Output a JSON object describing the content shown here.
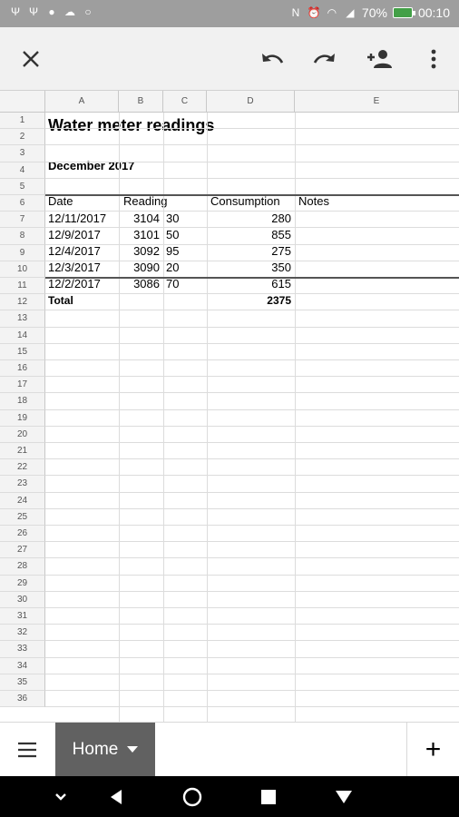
{
  "statusbar": {
    "battery_text": "70%",
    "time": "00:10"
  },
  "toolbar": {
    "close": "close-icon",
    "undo": "undo-icon",
    "redo": "redo-icon",
    "share": "add-person-icon",
    "more": "more-vert-icon"
  },
  "sheet": {
    "columns": [
      "A",
      "B",
      "C",
      "D",
      "E"
    ],
    "row_numbers": [
      "1",
      "2",
      "3",
      "4",
      "5",
      "6",
      "7",
      "8",
      "9",
      "10",
      "11",
      "12",
      "13",
      "14",
      "15",
      "16",
      "17",
      "18",
      "19",
      "20",
      "21",
      "22",
      "23",
      "24",
      "25",
      "26",
      "27",
      "28",
      "29",
      "30",
      "31",
      "32",
      "33",
      "34",
      "35",
      "36"
    ],
    "title": "Water meter readings",
    "month": "December 2017",
    "headers": {
      "date": "Date",
      "reading": "Reading",
      "consumption": "Consumption",
      "notes": "Notes"
    },
    "rows": [
      {
        "date": "12/11/2017",
        "reading_whole": "3104",
        "reading_dec": "30",
        "consumption": "280"
      },
      {
        "date": "12/9/2017",
        "reading_whole": "3101",
        "reading_dec": "50",
        "consumption": "855"
      },
      {
        "date": "12/4/2017",
        "reading_whole": "3092",
        "reading_dec": "95",
        "consumption": "275"
      },
      {
        "date": "12/3/2017",
        "reading_whole": "3090",
        "reading_dec": "20",
        "consumption": "350"
      },
      {
        "date": "12/2/2017",
        "reading_whole": "3086",
        "reading_dec": "70",
        "consumption": "615"
      }
    ],
    "total_label": "Total",
    "total_value": "2375"
  },
  "tabs": {
    "active": "Home",
    "add": "+"
  }
}
